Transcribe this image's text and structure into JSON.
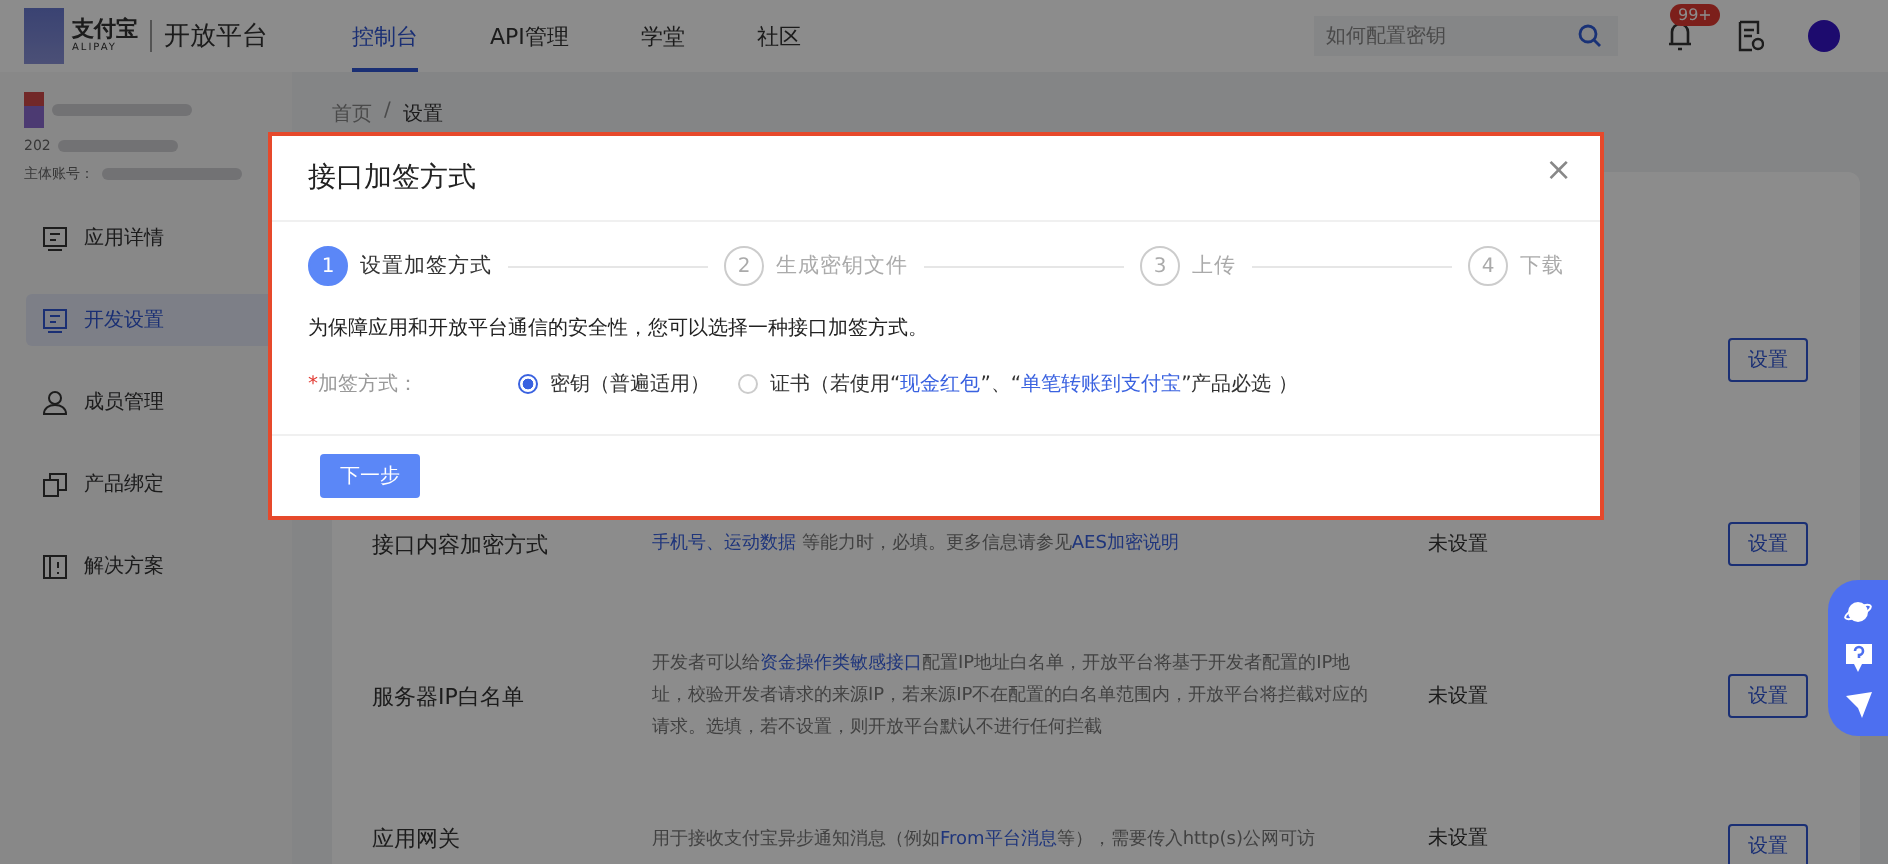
{
  "header": {
    "brand": "支付宝",
    "brand_sub": "ALIPAY",
    "product": "开放平台",
    "nav": [
      {
        "label": "控制台",
        "selected": true
      },
      {
        "label": "API管理",
        "selected": false
      },
      {
        "label": "学堂",
        "selected": false
      },
      {
        "label": "社区",
        "selected": false
      }
    ],
    "search": {
      "placeholder": "如何配置密钥"
    },
    "notification_badge": "99+"
  },
  "account": {
    "id_prefix": "202",
    "owner_label": "主体账号："
  },
  "sidebar": {
    "items": [
      {
        "label": "应用详情",
        "selected": false
      },
      {
        "label": "开发设置",
        "selected": true
      },
      {
        "label": "成员管理",
        "selected": false
      },
      {
        "label": "产品绑定",
        "selected": false
      },
      {
        "label": "解决方案",
        "selected": false
      }
    ]
  },
  "breadcrumb": {
    "separator": "/",
    "items": [
      {
        "label": "首页"
      },
      {
        "label": "设置"
      }
    ]
  },
  "settings": {
    "rows": [
      {
        "button": "设置"
      },
      {
        "title": "接口内容加密方式",
        "description": [
          {
            "text": "手机号、运动数据",
            "link": true
          },
          {
            "text": " 等能力时，必填。更多信息请参见",
            "link": false
          },
          {
            "text": "AES加密说明",
            "link": true
          }
        ],
        "status": "未设置",
        "button": "设置"
      },
      {
        "title": "服务器IP白名单",
        "description": [
          {
            "text": "开发者可以给",
            "link": false
          },
          {
            "text": "资金操作类敏感接口",
            "link": true
          },
          {
            "text": "配置IP地址白名单，开放平台将基于开发者配置的IP地址，校验开发者请求的来源IP，若来源IP不在配置的白名单范围内，开放平台将拦截对应的请求。选填，若不设置，则开放平台默认不进行任何拦截",
            "link": false
          }
        ],
        "status": "未设置",
        "button": "设置"
      },
      {
        "title": "应用网关",
        "description": [
          {
            "text": "用于接收支付宝异步通知消息（例如",
            "link": false
          },
          {
            "text": "From平台消息",
            "link": true
          },
          {
            "text": "等），需要传入http(s)公网可访",
            "link": false
          }
        ],
        "status": "未设置",
        "button": "设置"
      }
    ]
  },
  "dialog": {
    "title": "接口加签方式",
    "close": "×",
    "steps": [
      {
        "number": "1",
        "label": "设置加签方式",
        "active": true
      },
      {
        "number": "2",
        "label": "生成密钥文件",
        "active": false
      },
      {
        "number": "3",
        "label": "上传",
        "active": false
      },
      {
        "number": "4",
        "label": "下载",
        "active": false
      }
    ],
    "intro": "为保障应用和开放平台通信的安全性，您可以选择一种接口加签方式。",
    "required_mark": "*",
    "field_label": "加签方式：",
    "options": [
      {
        "selected": true,
        "label": [
          {
            "text": "密钥（普遍适用）",
            "link": false
          }
        ]
      },
      {
        "selected": false,
        "label": [
          {
            "text": "证书（若使用“",
            "link": false
          },
          {
            "text": "现金红包",
            "link": true
          },
          {
            "text": "”、“",
            "link": false
          },
          {
            "text": "单笔转账到支付宝",
            "link": true
          },
          {
            "text": "”产品必选 ）",
            "link": false
          }
        ]
      }
    ],
    "next_button": "下一步"
  }
}
